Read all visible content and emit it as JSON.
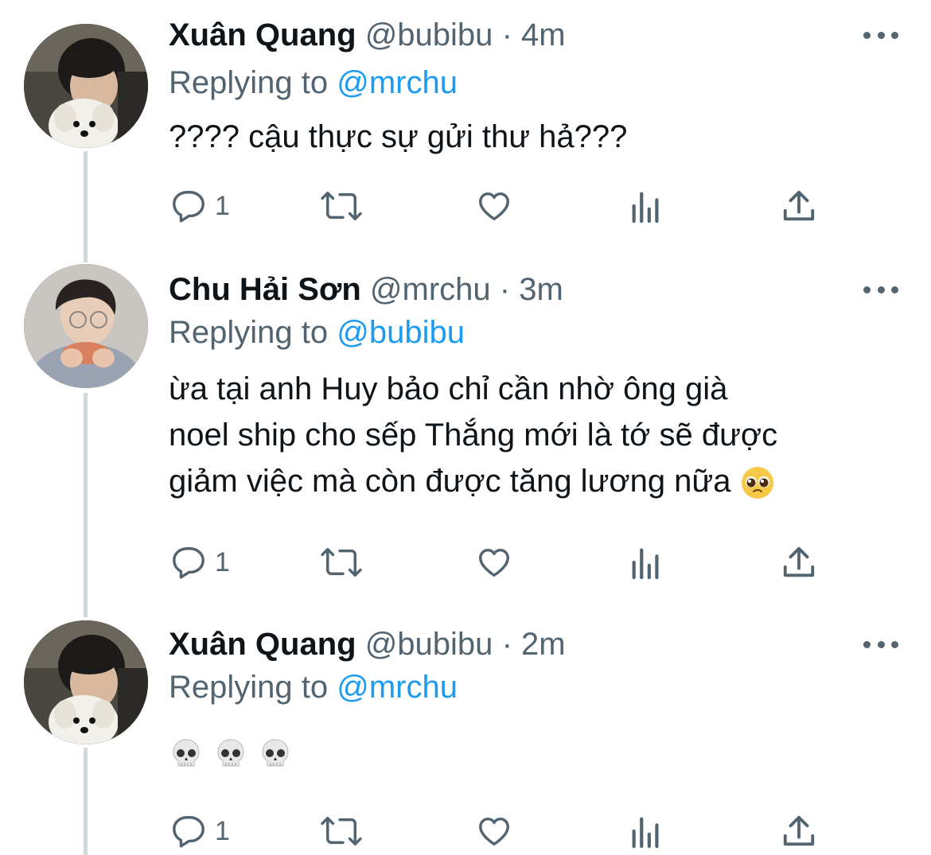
{
  "tweets": [
    {
      "name": "Xuân Quang",
      "handle": "@bubibu",
      "separator": "·",
      "time": "4m",
      "replying_prefix": "Replying to",
      "replying_to": "@mrchu",
      "text": "???? cậu thực sự gửi thư hả???",
      "reply_count": "1",
      "avatar": "avatar-boy-with-dog"
    },
    {
      "name": "Chu Hải Sơn",
      "handle": "@mrchu",
      "separator": "·",
      "time": "3m",
      "replying_prefix": "Replying to",
      "replying_to": "@bubibu",
      "text_lines": [
        "ừa tại anh Huy bảo chỉ cần nhờ ông già",
        "noel ship cho sếp Thắng mới là tớ sẽ được",
        "giảm việc mà còn được tăng lương nữa"
      ],
      "emoji": "pleading-face",
      "reply_count": "1",
      "avatar": "avatar-boy-with-glasses"
    },
    {
      "name": "Xuân Quang",
      "handle": "@bubibu",
      "separator": "·",
      "time": "2m",
      "replying_prefix": "Replying to",
      "replying_to": "@mrchu",
      "emojis": [
        "skull",
        "skull",
        "skull"
      ],
      "reply_count": "1",
      "avatar": "avatar-boy-with-dog"
    }
  ],
  "icons": {
    "reply": "reply-icon",
    "retweet": "retweet-icon",
    "like": "like-icon",
    "analytics": "analytics-icon",
    "share": "share-icon",
    "more": "more-icon"
  },
  "colors": {
    "text": "#0f1419",
    "secondary": "#536471",
    "mention": "#1d9bf0",
    "thread_line": "#cfd9de"
  }
}
